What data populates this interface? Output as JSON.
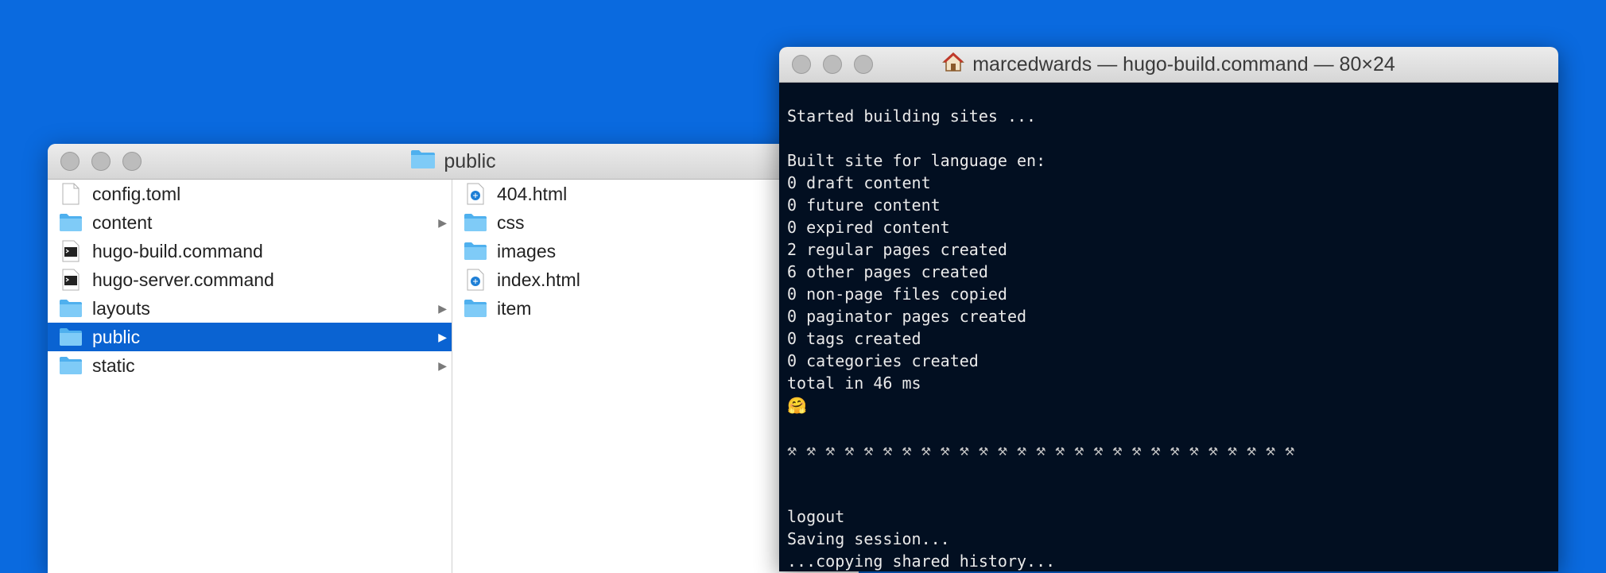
{
  "finder": {
    "title": "public",
    "columns": [
      [
        {
          "name": "config.toml",
          "icon": "document-icon",
          "arrow": false,
          "selected": false
        },
        {
          "name": "content",
          "icon": "folder-icon",
          "arrow": true,
          "selected": false
        },
        {
          "name": "hugo-build.command",
          "icon": "terminal-file-icon",
          "arrow": false,
          "selected": false
        },
        {
          "name": "hugo-server.command",
          "icon": "terminal-file-icon",
          "arrow": false,
          "selected": false
        },
        {
          "name": "layouts",
          "icon": "folder-icon",
          "arrow": true,
          "selected": false
        },
        {
          "name": "public",
          "icon": "folder-icon",
          "arrow": true,
          "selected": true
        },
        {
          "name": "static",
          "icon": "folder-icon",
          "arrow": true,
          "selected": false
        }
      ],
      [
        {
          "name": "404.html",
          "icon": "html-file-icon",
          "arrow": false,
          "selected": false
        },
        {
          "name": "css",
          "icon": "folder-icon",
          "arrow": false,
          "selected": false
        },
        {
          "name": "images",
          "icon": "folder-icon",
          "arrow": false,
          "selected": false
        },
        {
          "name": "index.html",
          "icon": "html-file-icon",
          "arrow": false,
          "selected": false
        },
        {
          "name": "item",
          "icon": "folder-icon",
          "arrow": false,
          "selected": false
        }
      ]
    ]
  },
  "terminal": {
    "title": "marcedwards — hugo-build.command — 80×24",
    "lines": [
      "",
      "Started building sites ...",
      "",
      "Built site for language en:",
      "0 draft content",
      "0 future content",
      "0 expired content",
      "2 regular pages created",
      "6 other pages created",
      "0 non-page files copied",
      "0 paginator pages created",
      "0 tags created",
      "0 categories created",
      "total in 46 ms",
      "🤗",
      "",
      "⚒ ⚒ ⚒ ⚒ ⚒ ⚒ ⚒ ⚒ ⚒ ⚒ ⚒ ⚒ ⚒ ⚒ ⚒ ⚒ ⚒ ⚒ ⚒ ⚒ ⚒ ⚒ ⚒ ⚒ ⚒ ⚒ ⚒",
      "",
      "",
      "logout",
      "Saving session...",
      "...copying shared history..."
    ]
  },
  "colors": {
    "desktop": "#0a6adf",
    "selection": "#0a63d2",
    "terminal_bg": "#020f21",
    "folder": "#6cc3f5"
  }
}
